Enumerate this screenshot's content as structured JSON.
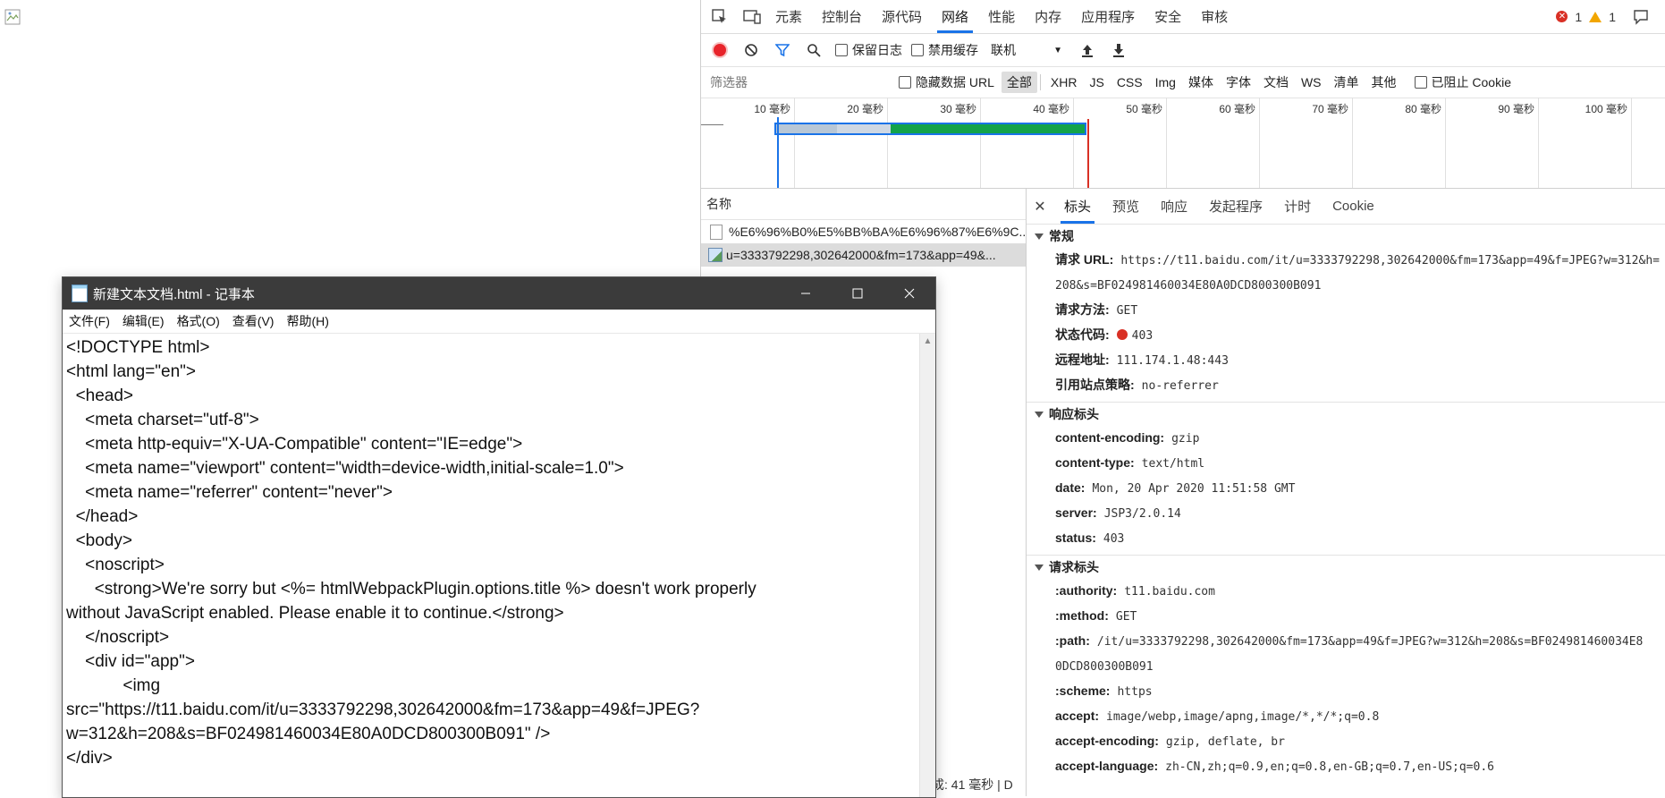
{
  "devtools": {
    "tabs": [
      "元素",
      "控制台",
      "源代码",
      "网络",
      "性能",
      "内存",
      "应用程序",
      "安全",
      "审核"
    ],
    "errors": "1",
    "warnings": "1",
    "toolbar": {
      "preserve_log": "保留日志",
      "disable_cache": "禁用缓存",
      "throttle": "联机"
    },
    "filter": {
      "placeholder": "筛选器",
      "hide_data_url": "隐藏数据 URL",
      "types": [
        "全部",
        "XHR",
        "JS",
        "CSS",
        "Img",
        "媒体",
        "字体",
        "文档",
        "WS",
        "清单",
        "其他"
      ],
      "blocked_cookies": "已阻止 Cookie"
    },
    "overview_ticks": [
      "10 毫秒",
      "20 毫秒",
      "30 毫秒",
      "40 毫秒",
      "50 毫秒",
      "60 毫秒",
      "70 毫秒",
      "80 毫秒",
      "90 毫秒",
      "100 毫秒"
    ],
    "request_list": {
      "header": "名称",
      "rows": [
        "%E6%96%B0%E5%BB%BA%E6%96%87%E6%9C...",
        "u=3333792298,302642000&fm=173&app=49&..."
      ],
      "footer": "成: 41 毫秒 | D"
    },
    "details": {
      "tabs": [
        "标头",
        "预览",
        "响应",
        "发起程序",
        "计时",
        "Cookie"
      ],
      "general_title": "常规",
      "general": {
        "url_key": "请求 URL:",
        "url_line1": "https://t11.baidu.com/it/u=3333792298,302642000&fm=173&app=49&f=JPEG?w=312&h=",
        "url_line2": "208&s=BF024981460034E80A0DCD800300B091",
        "method_key": "请求方法:",
        "method": "GET",
        "status_key": "状态代码:",
        "status": "403",
        "remote_key": "远程地址:",
        "remote": "111.174.1.48:443",
        "referrer_key": "引用站点策略:",
        "referrer": "no-referrer"
      },
      "response_title": "响应标头",
      "response_headers": [
        {
          "k": "content-encoding:",
          "v": "gzip"
        },
        {
          "k": "content-type:",
          "v": "text/html"
        },
        {
          "k": "date:",
          "v": "Mon, 20 Apr 2020 11:51:58 GMT"
        },
        {
          "k": "server:",
          "v": "JSP3/2.0.14"
        },
        {
          "k": "status:",
          "v": "403"
        }
      ],
      "request_title": "请求标头",
      "request_headers": [
        {
          "k": ":authority:",
          "v": "t11.baidu.com"
        },
        {
          "k": ":method:",
          "v": "GET"
        },
        {
          "k": ":path:",
          "v": "/it/u=3333792298,302642000&fm=173&app=49&f=JPEG?w=312&h=208&s=BF024981460034E8"
        },
        {
          "k": "",
          "v": "0DCD800300B091"
        },
        {
          "k": ":scheme:",
          "v": "https"
        },
        {
          "k": "accept:",
          "v": "image/webp,image/apng,image/*,*/*;q=0.8"
        },
        {
          "k": "accept-encoding:",
          "v": "gzip, deflate, br"
        },
        {
          "k": "accept-language:",
          "v": "zh-CN,zh;q=0.9,en;q=0.8,en-GB;q=0.7,en-US;q=0.6"
        }
      ]
    }
  },
  "notepad": {
    "title": "新建文本文档.html - 记事本",
    "menu": [
      "文件(F)",
      "编辑(E)",
      "格式(O)",
      "查看(V)",
      "帮助(H)"
    ],
    "content": "<!DOCTYPE html>\n<html lang=\"en\">\n  <head>\n    <meta charset=\"utf-8\">\n    <meta http-equiv=\"X-UA-Compatible\" content=\"IE=edge\">\n    <meta name=\"viewport\" content=\"width=device-width,initial-scale=1.0\">\n    <meta name=\"referrer\" content=\"never\">\n  </head>\n  <body>\n    <noscript>\n      <strong>We're sorry but <%= htmlWebpackPlugin.options.title %> doesn't work properly\nwithout JavaScript enabled. Please enable it to continue.</strong>\n    </noscript>\n    <div id=\"app\">\n            <img\nsrc=\"https://t11.baidu.com/it/u=3333792298,302642000&fm=173&app=49&f=JPEG?\nw=312&h=208&s=BF024981460034E80A0DCD800300B091\" />\n</div>"
  }
}
